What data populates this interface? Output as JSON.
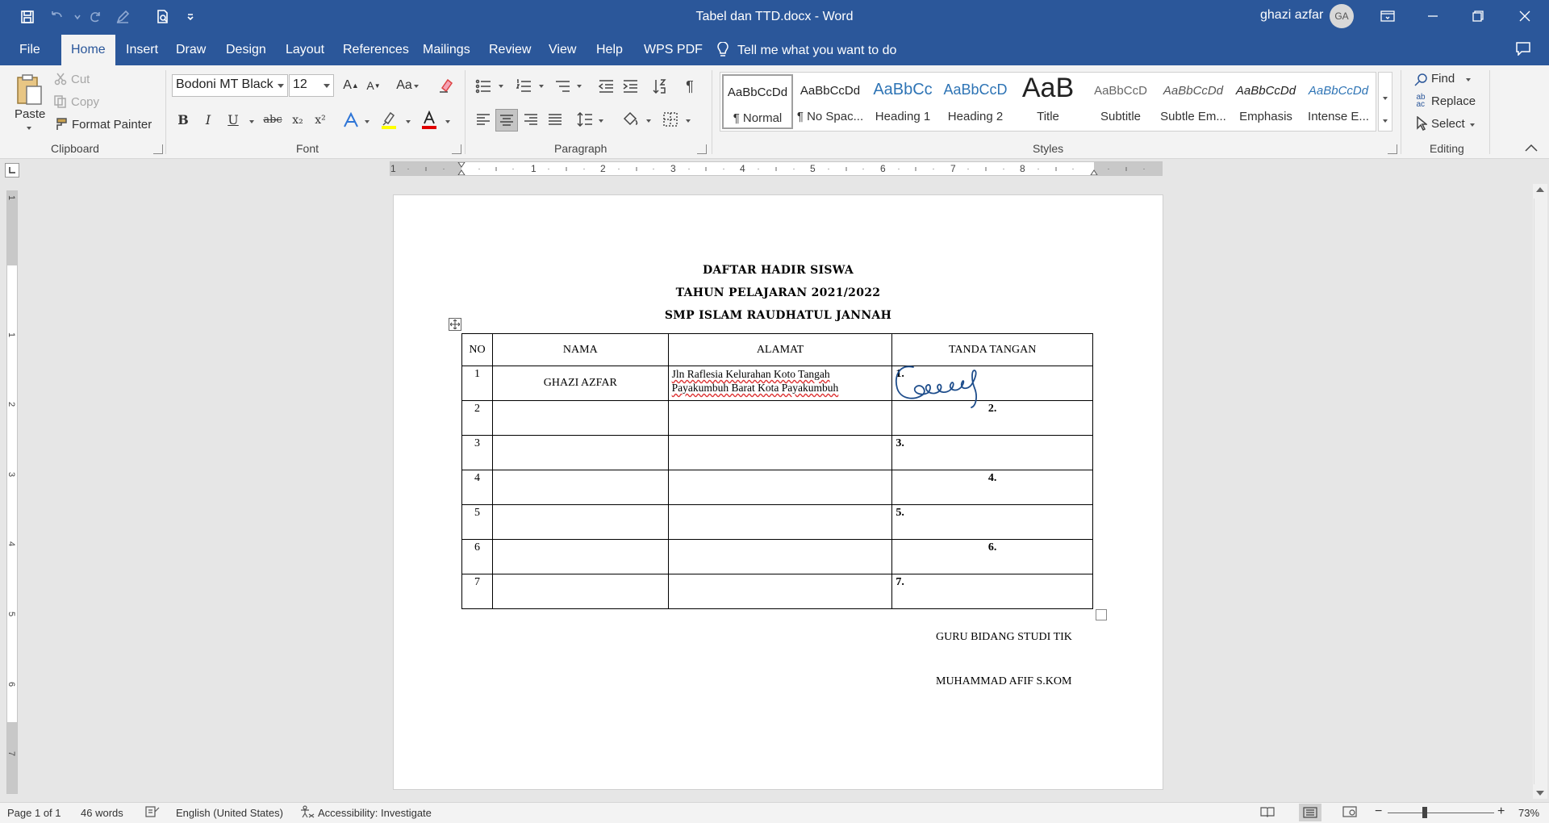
{
  "window": {
    "title": "Tabel dan TTD.docx  -  Word",
    "user_name": "ghazi azfar",
    "user_initials": "GA"
  },
  "tabs": [
    "File",
    "Home",
    "Insert",
    "Draw",
    "Design",
    "Layout",
    "References",
    "Mailings",
    "Review",
    "View",
    "Help",
    "WPS PDF"
  ],
  "active_tab": "Home",
  "tell_me": "Tell me what you want to do",
  "clipboard": {
    "paste": "Paste",
    "cut": "Cut",
    "copy": "Copy",
    "format_painter": "Format Painter",
    "label": "Clipboard"
  },
  "font": {
    "name": "Bodoni MT Black",
    "size": "12",
    "label": "Font",
    "bold": "B",
    "italic": "I",
    "underline": "U",
    "strike": "abc",
    "subscript": "x₂",
    "superscript": "x²",
    "grow": "A",
    "shrink": "A",
    "case": "Aa"
  },
  "paragraph": {
    "label": "Paragraph"
  },
  "styles": {
    "label": "Styles",
    "items": [
      {
        "sample": "AaBbCcDd",
        "name": "¶ Normal"
      },
      {
        "sample": "AaBbCcDd",
        "name": "¶ No Spac..."
      },
      {
        "sample": "AaBbCc",
        "name": "Heading 1"
      },
      {
        "sample": "AaBbCcD",
        "name": "Heading 2"
      },
      {
        "sample": "AaB",
        "name": "Title"
      },
      {
        "sample": "AaBbCcD",
        "name": "Subtitle"
      },
      {
        "sample": "AaBbCcDd",
        "name": "Subtle Em..."
      },
      {
        "sample": "AaBbCcDd",
        "name": "Emphasis"
      },
      {
        "sample": "AaBbCcDd",
        "name": "Intense E..."
      }
    ]
  },
  "editing": {
    "label": "Editing",
    "find": "Find",
    "replace": "Replace",
    "select": "Select"
  },
  "ruler": {
    "h_numbers": [
      "1",
      "1",
      "2",
      "3",
      "4",
      "5",
      "6",
      "7",
      "8"
    ],
    "v_numbers": [
      "1",
      "1",
      "2",
      "3",
      "4",
      "5",
      "6",
      "7"
    ]
  },
  "document": {
    "headings": [
      "DAFTAR HADIR SISWA",
      "TAHUN PELAJARAN 2021/2022",
      "SMP ISLAM RAUDHATUL JANNAH"
    ],
    "table": {
      "headers": [
        "NO",
        "NAMA",
        "ALAMAT",
        "TANDA TANGAN"
      ],
      "rows": [
        {
          "no": "1",
          "nama": "GHAZI AZFAR",
          "alamat": "Jln Raflesia Kelurahan Koto Tangah Payakumbuh Barat Kota Payakumbuh",
          "ttd": "1."
        },
        {
          "no": "2",
          "nama": "",
          "alamat": "",
          "ttd": "2."
        },
        {
          "no": "3",
          "nama": "",
          "alamat": "",
          "ttd": "3."
        },
        {
          "no": "4",
          "nama": "",
          "alamat": "",
          "ttd": "4."
        },
        {
          "no": "5",
          "nama": "",
          "alamat": "",
          "ttd": "5."
        },
        {
          "no": "6",
          "nama": "",
          "alamat": "",
          "ttd": "6."
        },
        {
          "no": "7",
          "nama": "",
          "alamat": "",
          "ttd": "7."
        }
      ]
    },
    "signatory_title": "GURU BIDANG STUDI TIK",
    "signatory_name": "MUHAMMAD AFIF S.KOM"
  },
  "status": {
    "page": "Page 1 of 1",
    "words": "46 words",
    "language": "English (United States)",
    "accessibility": "Accessibility: Investigate",
    "zoom": "73%",
    "zoom_minus": "−",
    "zoom_plus": "+"
  },
  "colors": {
    "brand": "#2b579a",
    "ribbon_bg": "#f3f3f3",
    "signature_ink": "#1f4e8c",
    "highlight_yellow": "#ffff00",
    "font_color_red": "#e00000"
  }
}
